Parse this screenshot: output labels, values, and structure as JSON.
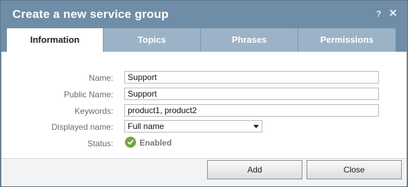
{
  "dialog": {
    "title": "Create a new service group",
    "help_label": "?",
    "close_label": "✕"
  },
  "tabs": [
    {
      "label": "Information",
      "active": true
    },
    {
      "label": "Topics",
      "active": false
    },
    {
      "label": "Phrases",
      "active": false
    },
    {
      "label": "Permissions",
      "active": false
    }
  ],
  "form": {
    "name": {
      "label": "Name:",
      "value": "Support"
    },
    "public_name": {
      "label": "Public Name:",
      "value": "Support"
    },
    "keywords": {
      "label": "Keywords:",
      "value": "product1, product2"
    },
    "displayed_name": {
      "label": "Displayed name:",
      "selected": "Full name"
    },
    "status": {
      "label": "Status:",
      "value": "Enabled",
      "icon": "check-circle-icon",
      "color": "#71a83a"
    }
  },
  "footer": {
    "add_label": "Add",
    "close_label": "Close"
  }
}
